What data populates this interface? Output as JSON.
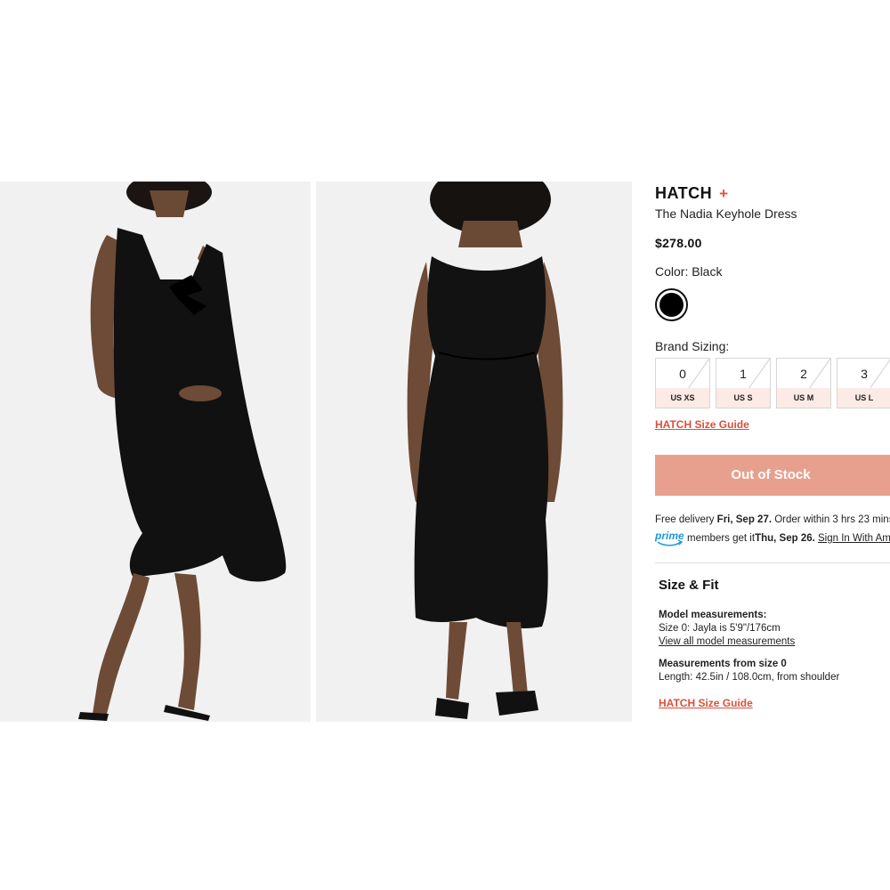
{
  "gallery": {
    "front_image_icon": "model-front-photo",
    "back_image_icon": "model-back-photo"
  },
  "product": {
    "brand": "HATCH",
    "favorite_icon": "plus-icon",
    "favorite_symbol": "+",
    "name": "The Nadia Keyhole Dress",
    "price": "$278.00",
    "color_label": "Color: Black",
    "swatch_color": "#000000",
    "sizing_label": "Brand Sizing:",
    "sizes": [
      {
        "size": "0",
        "us": "US XS"
      },
      {
        "size": "1",
        "us": "US S"
      },
      {
        "size": "2",
        "us": "US M"
      },
      {
        "size": "3",
        "us": "US L"
      }
    ],
    "size_guide_link": "HATCH Size Guide",
    "button_label": "Out of Stock"
  },
  "delivery": {
    "line1_prefix": "Free delivery ",
    "line1_date": "Fri, Sep 27.",
    "line1_suffix": " Order within 3 hrs 23 mins",
    "prime_icon": "prime-logo",
    "line2_prefix": "members get it ",
    "line2_date": "Thu, Sep 26.",
    "line2_link": "Sign In With Amazon"
  },
  "size_fit": {
    "title": "Size & Fit",
    "model_heading": "Model measurements:",
    "model_line": "Size 0: Jayla is 5'9\"/176cm",
    "model_link": "View all model measurements",
    "measure_heading": "Measurements from size 0",
    "measure_line": "Length: 42.5in / 108.0cm, from shoulder",
    "guide_link": "HATCH Size Guide"
  },
  "colors": {
    "accent": "#e0533d",
    "button_bg": "#e8a08e",
    "size_tag_bg": "#fbeae5"
  }
}
